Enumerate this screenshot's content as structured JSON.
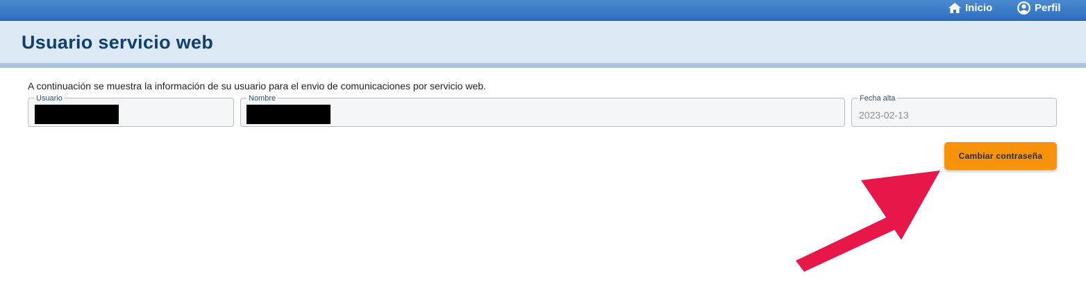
{
  "nav": {
    "home_label": "Inicio",
    "profile_label": "Perfil"
  },
  "header": {
    "title": "Usuario servicio web"
  },
  "intro": "A continuación se muestra la información de su usuario para el envio de comunicaciones por servicio web.",
  "fields": {
    "usuario": {
      "label": "Usuario",
      "value": ""
    },
    "nombre": {
      "label": "Nombre",
      "value": ""
    },
    "fecha_alta": {
      "label": "Fecha alta",
      "value": "2023-02-13"
    }
  },
  "actions": {
    "change_password_label": "Cambiar contraseña"
  },
  "colors": {
    "topbar": "#2d6fc0",
    "title_text": "#0f3f6e",
    "button": "#f7930a",
    "arrow": "#e8174a"
  },
  "icons": {
    "home": "home-icon",
    "profile": "user-circle-icon",
    "annotation": "arrow-icon"
  }
}
